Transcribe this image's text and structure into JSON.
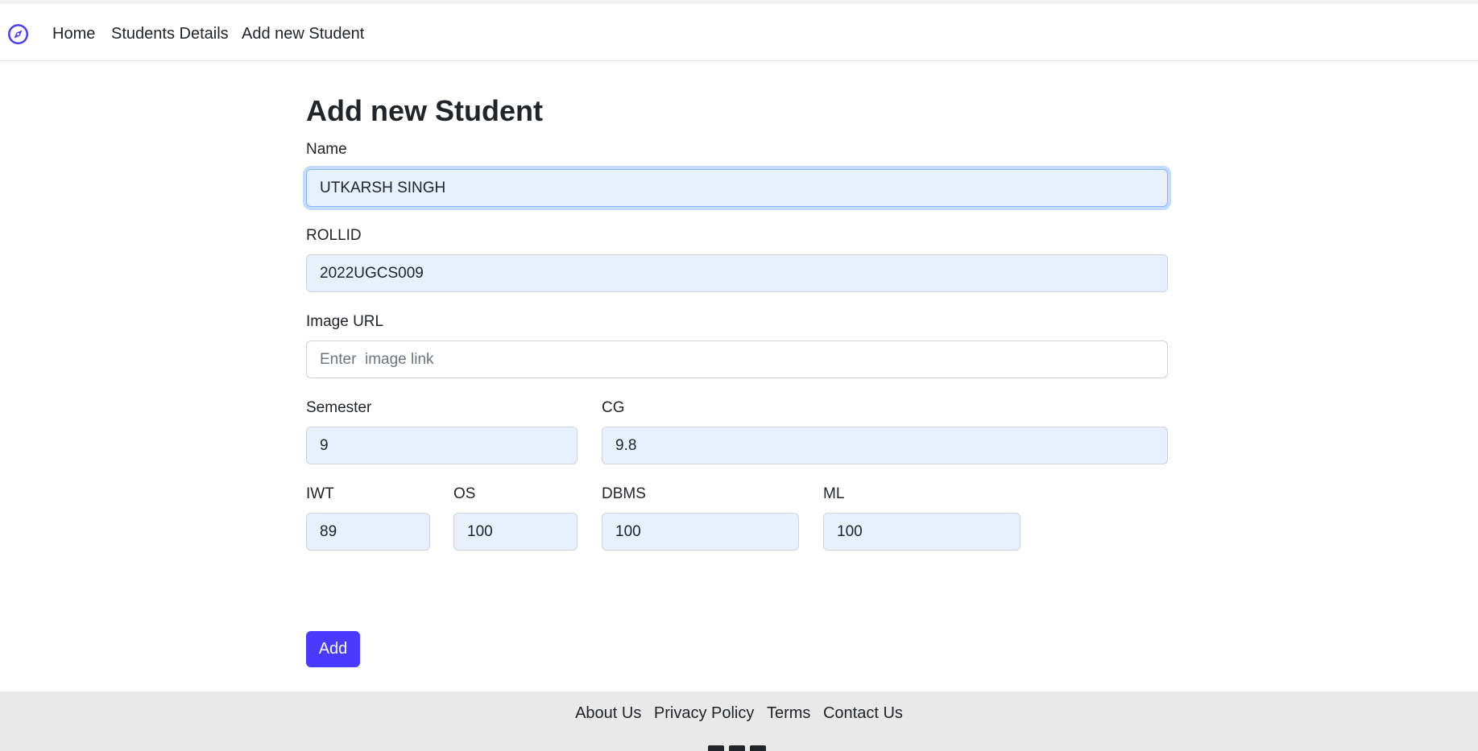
{
  "nav": {
    "brand_icon": "compass-icon",
    "links": [
      "Home",
      "Students Details",
      "Add new Student"
    ]
  },
  "form": {
    "title": "Add new Student",
    "name": {
      "label": "Name",
      "value": "UTKARSH SINGH"
    },
    "rollid": {
      "label": "ROLLID",
      "value": "2022UGCS009"
    },
    "image_url": {
      "label": "Image URL",
      "value": "",
      "placeholder": "Enter  image link"
    },
    "semester": {
      "label": "Semester",
      "value": "9"
    },
    "cg": {
      "label": "CG",
      "value": "9.8"
    },
    "iwt": {
      "label": "IWT",
      "value": "89"
    },
    "os": {
      "label": "OS",
      "value": "100"
    },
    "dbms": {
      "label": "DBMS",
      "value": "100"
    },
    "ml": {
      "label": "ML",
      "value": "100"
    },
    "submit_label": "Add"
  },
  "footer": {
    "links": [
      "About Us",
      "Privacy Policy",
      "Terms",
      "Contact Us"
    ]
  },
  "colors": {
    "accent": "#4a3aff",
    "autofill_bg": "#e8f0fe",
    "footer_bg": "#e9e9e9"
  }
}
